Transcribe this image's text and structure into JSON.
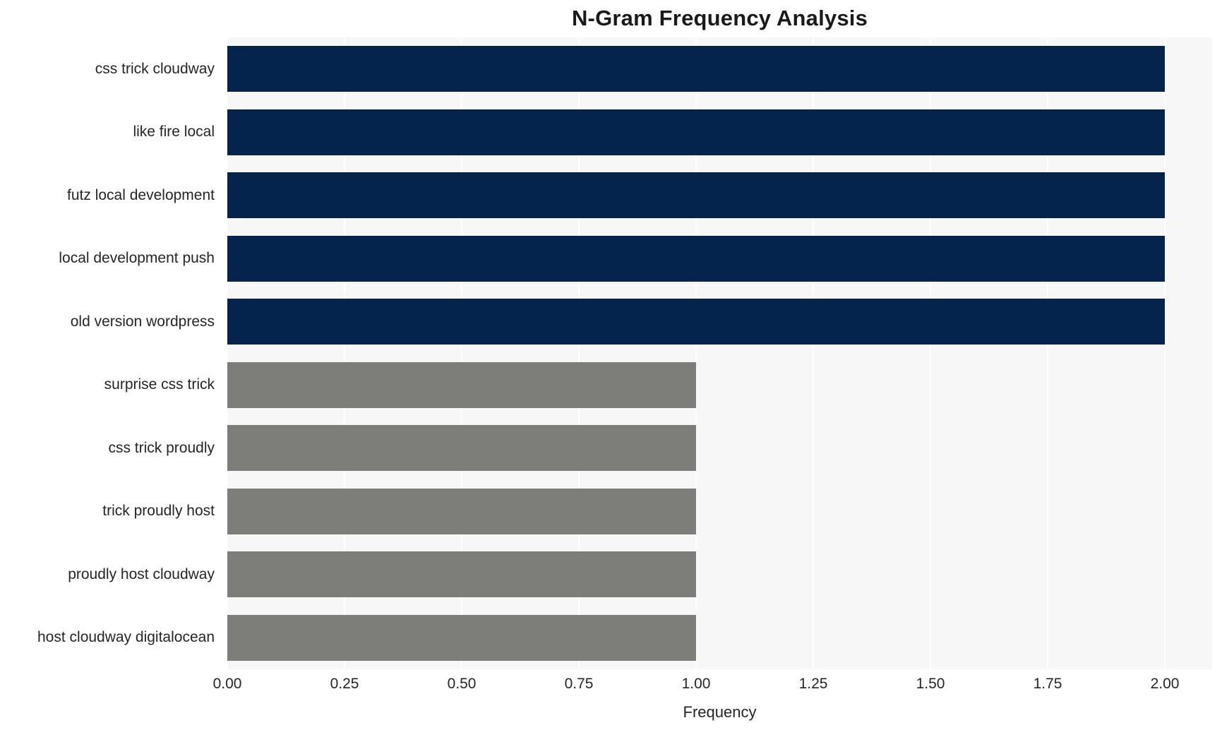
{
  "chart_data": {
    "type": "bar",
    "orientation": "horizontal",
    "title": "N-Gram Frequency Analysis",
    "xlabel": "Frequency",
    "ylabel": "",
    "xlim": [
      0,
      2
    ],
    "ylim": null,
    "grid": true,
    "legend": null,
    "xticks": [
      "0.00",
      "0.25",
      "0.50",
      "0.75",
      "1.00",
      "1.25",
      "1.50",
      "1.75",
      "2.00"
    ],
    "xtick_values": [
      0,
      0.25,
      0.5,
      0.75,
      1,
      1.25,
      1.5,
      1.75,
      2
    ],
    "categories": [
      "css trick cloudway",
      "like fire local",
      "futz local development",
      "local development push",
      "old version wordpress",
      "surprise css trick",
      "css trick proudly",
      "trick proudly host",
      "proudly host cloudway",
      "host cloudway digitalocean"
    ],
    "values": [
      2,
      2,
      2,
      2,
      2,
      1,
      1,
      1,
      1,
      1
    ],
    "bar_colors": [
      "#04234d",
      "#04234d",
      "#04234d",
      "#04234d",
      "#04234d",
      "#7d7d7a",
      "#7d7d7a",
      "#7d7d7a",
      "#7d7d7a",
      "#7d7d7a"
    ]
  },
  "style": {
    "plot_background": "#f7f7f7",
    "figure_background": "#ffffff",
    "gridline_color": "#ffffff",
    "text_color": "#262626",
    "title_color": "#1a1a1a",
    "highlight_color": "#04234d",
    "muted_color": "#7d7d7a"
  }
}
